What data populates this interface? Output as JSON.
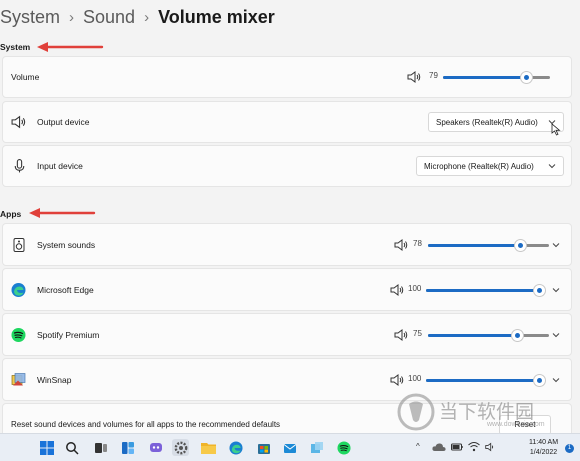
{
  "breadcrumb": {
    "items": [
      "System",
      "Sound"
    ],
    "current": "Volume mixer"
  },
  "sections": {
    "system": "System",
    "apps": "Apps"
  },
  "system": {
    "volume": {
      "label": "Volume",
      "value": "79",
      "level": 79
    },
    "output": {
      "label": "Output device",
      "selected": "Speakers (Realtek(R) Audio)"
    },
    "input": {
      "label": "Input device",
      "selected": "Microphone (Realtek(R) Audio)"
    }
  },
  "apps": [
    {
      "label": "System sounds",
      "value": "78",
      "level": 78,
      "icon": "speaker-device-icon"
    },
    {
      "label": "Microsoft Edge",
      "value": "100",
      "level": 100,
      "icon": "edge-icon"
    },
    {
      "label": "Spotify Premium",
      "value": "75",
      "level": 75,
      "icon": "spotify-icon"
    },
    {
      "label": "WinSnap",
      "value": "100",
      "level": 100,
      "icon": "winsnap-icon"
    }
  ],
  "reset": {
    "text": "Reset sound devices and volumes for all apps to the recommended defaults",
    "button": "Reset"
  },
  "watermark": {
    "text": "当下软件园",
    "url": "www.downxia.com"
  },
  "taskbar": {
    "time": "11:40 AM",
    "date": "1/4/2022",
    "notifications": "1"
  },
  "colors": {
    "accent": "#1c6bc4",
    "arrow": "#e0403a",
    "background": "#f3f3f3",
    "card": "#fbfbfb"
  }
}
